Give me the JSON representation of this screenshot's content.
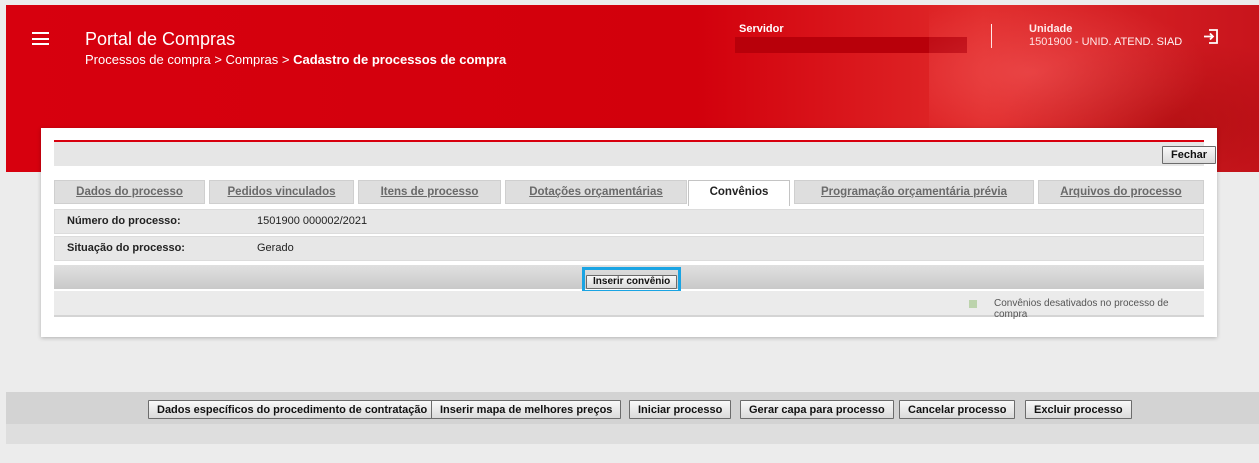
{
  "header": {
    "app_title": "Portal de Compras",
    "breadcrumb_part1": "Processos de compra > Compras > ",
    "breadcrumb_current": "Cadastro de processos de compra",
    "servidor_label": "Servidor",
    "servidor_value": "",
    "unidade_label": "Unidade",
    "unidade_value": "1501900 - UNID. ATEND. SIAD",
    "brand_color": "#d7000e"
  },
  "toolbar": {
    "fechar_label": "Fechar"
  },
  "tabs": [
    {
      "label": "Dados do processo",
      "active": false
    },
    {
      "label": "Pedidos vinculados",
      "active": false
    },
    {
      "label": "Itens de processo",
      "active": false
    },
    {
      "label": "Dotações orçamentárias",
      "active": false
    },
    {
      "label": "Convênios",
      "active": true
    },
    {
      "label": "Programação orçamentária prévia",
      "active": false
    },
    {
      "label": "Arquivos do processo",
      "active": false
    }
  ],
  "info": {
    "numero_label": "Número do processo:",
    "numero_value": "1501900 000002/2021",
    "situacao_label": "Situação do processo:",
    "situacao_value": "Gerado"
  },
  "actions": {
    "inserir_convenio_label": "Inserir convênio",
    "highlight_color": "#1aa4e3"
  },
  "legend": {
    "text": "Convênios desativados no processo de compra",
    "swatch_color": "#bcd3ac"
  },
  "bottom_buttons": [
    "Dados específicos do procedimento de contratação",
    "Inserir mapa de melhores preços",
    "Iniciar processo",
    "Gerar capa para processo",
    "Cancelar processo",
    "Excluir processo"
  ]
}
